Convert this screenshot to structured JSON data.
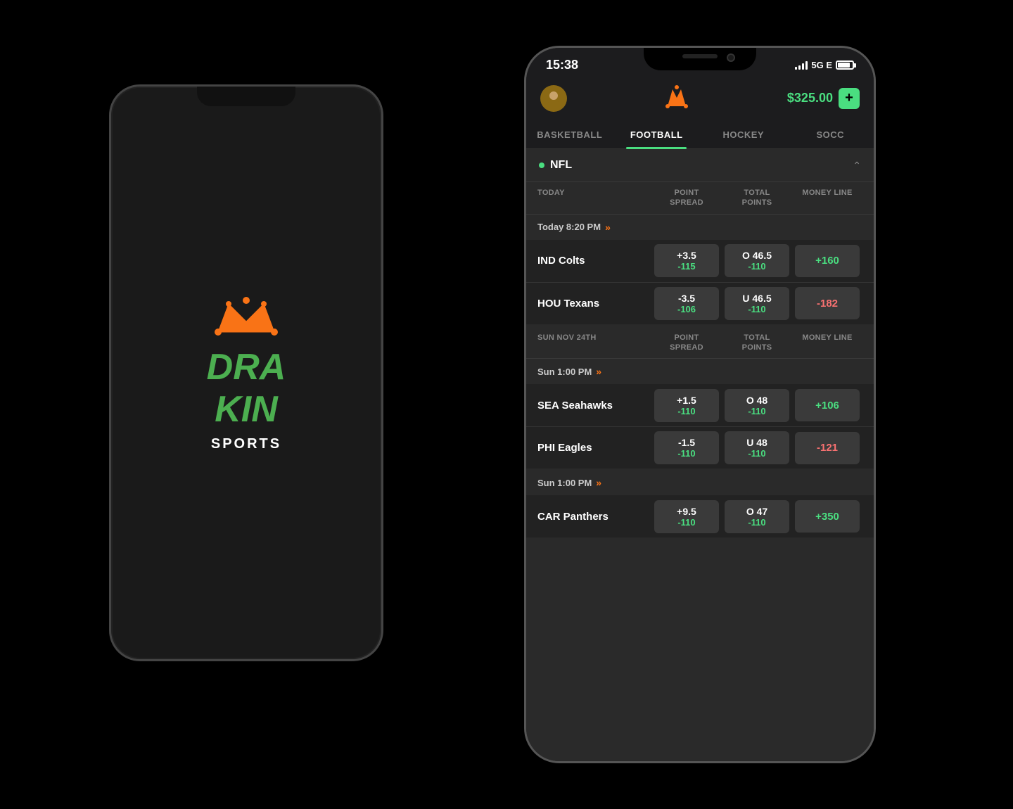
{
  "background": "#000000",
  "phone_back": {
    "logo_crown": "👑",
    "logo_text_green": "DRA",
    "logo_text_white": "KIN",
    "sports_label": "SPORTS"
  },
  "phone_front": {
    "status_bar": {
      "time": "15:38",
      "network": "5G E"
    },
    "header": {
      "balance": "$325.00",
      "add_label": "+"
    },
    "tabs": [
      {
        "id": "basketball",
        "label": "BASKETBALL",
        "active": false
      },
      {
        "id": "football",
        "label": "FOOTBALL",
        "active": true
      },
      {
        "id": "hockey",
        "label": "HOCKEY",
        "active": false
      },
      {
        "id": "soccer",
        "label": "SOCC",
        "active": false
      }
    ],
    "league": {
      "name": "NFL",
      "dot_color": "#4ade80"
    },
    "columns": {
      "today": "TODAY",
      "point_spread": "POINT\nSPREAD",
      "total_points": "TOTAL\nPOINTS",
      "money_line": "MONEY LINE"
    },
    "sections": [
      {
        "id": "today-section",
        "date_label": "TODAY",
        "col_today": "TODAY",
        "games": [
          {
            "time": "Today 8:20 PM",
            "teams": [
              {
                "name": "IND Colts",
                "point_spread_top": "+3.5",
                "point_spread_bot": "-115",
                "total_top": "O 46.5",
                "total_bot": "-110",
                "money": "+160",
                "money_positive": true
              },
              {
                "name": "HOU Texans",
                "point_spread_top": "-3.5",
                "point_spread_bot": "-106",
                "total_top": "U 46.5",
                "total_bot": "-110",
                "money": "-182",
                "money_positive": false
              }
            ]
          }
        ]
      },
      {
        "id": "sun-nov-24th-section",
        "date_label": "SUN NOV 24TH",
        "col_today": "SUN NOV 24TH",
        "games": [
          {
            "time": "Sun 1:00 PM",
            "teams": [
              {
                "name": "SEA Seahawks",
                "point_spread_top": "+1.5",
                "point_spread_bot": "-110",
                "total_top": "O 48",
                "total_bot": "-110",
                "money": "+106",
                "money_positive": true
              },
              {
                "name": "PHI Eagles",
                "point_spread_top": "-1.5",
                "point_spread_bot": "-110",
                "total_top": "U 48",
                "total_bot": "-110",
                "money": "-121",
                "money_positive": false
              }
            ]
          },
          {
            "time": "Sun 1:00 PM",
            "teams": [
              {
                "name": "CAR Panthers",
                "point_spread_top": "+9.5",
                "point_spread_bot": "-110",
                "total_top": "O 47",
                "total_bot": "-110",
                "money": "+350",
                "money_positive": true
              }
            ]
          }
        ]
      }
    ]
  }
}
